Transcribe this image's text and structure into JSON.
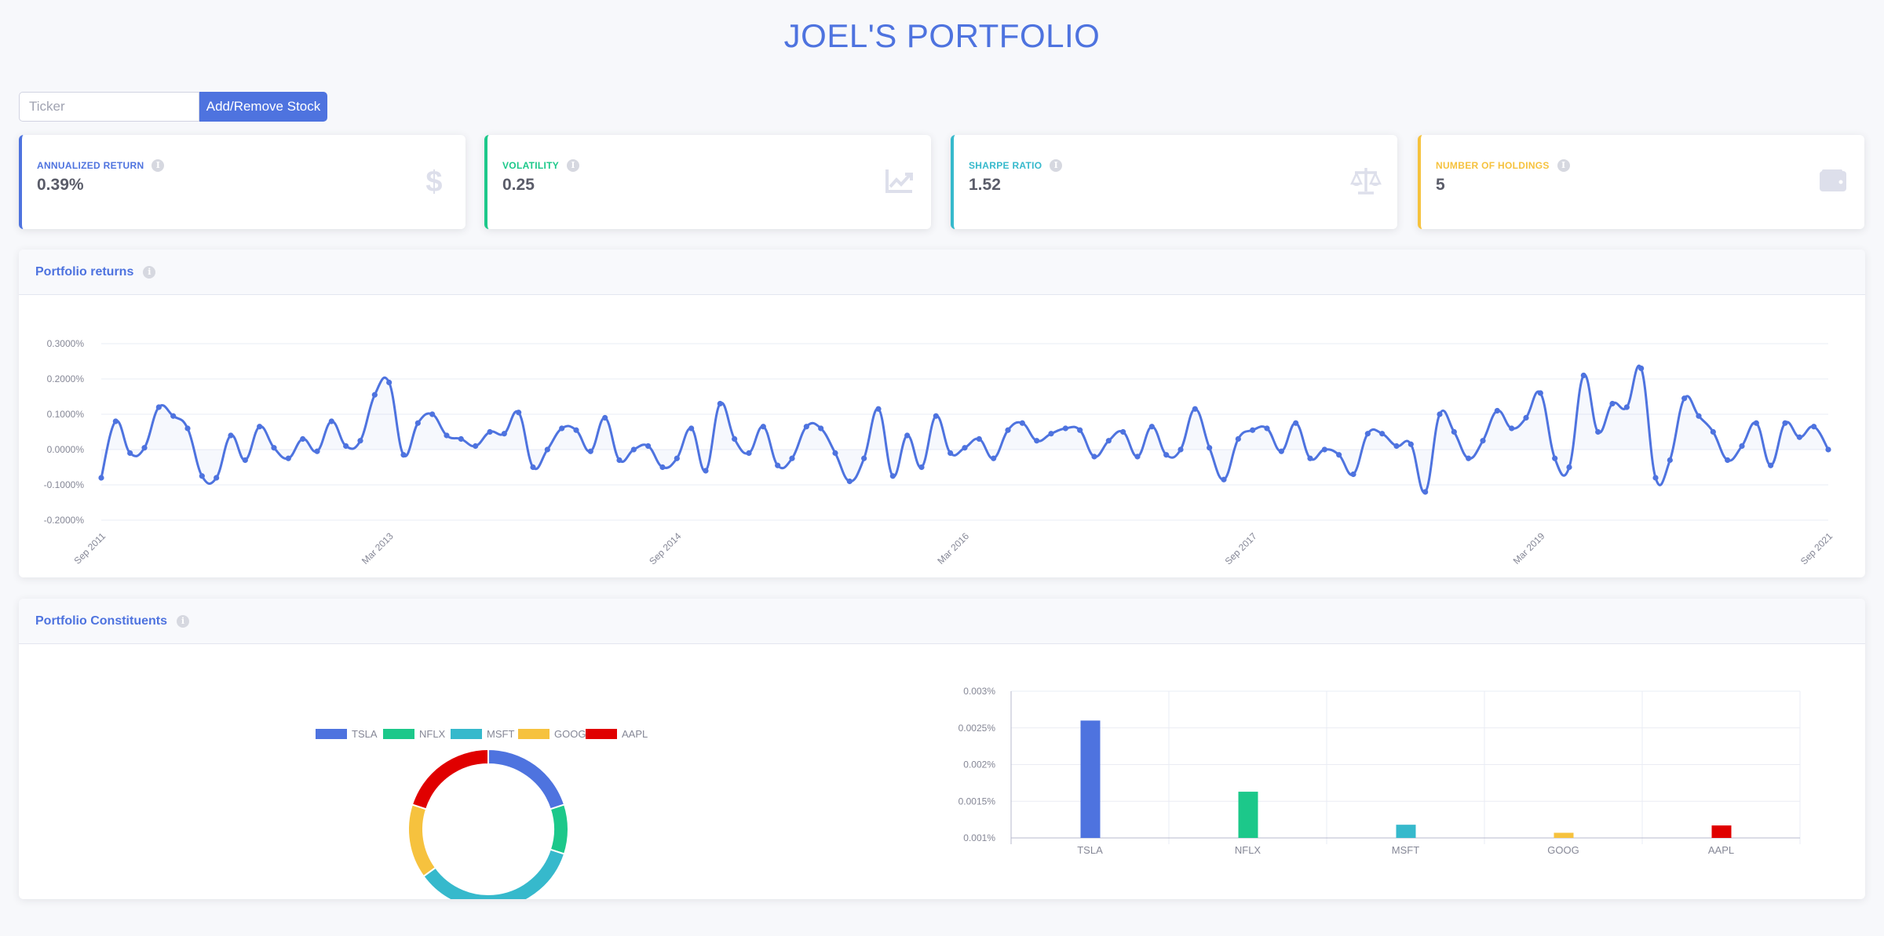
{
  "header": {
    "title": "JOEL'S PORTFOLIO"
  },
  "controls": {
    "ticker_placeholder": "Ticker",
    "add_remove_label": "Add/Remove Stock"
  },
  "info_glyph": "i",
  "stats": [
    {
      "label": "ANNUALIZED RETURN",
      "value": "0.39%",
      "color": "#4e73df",
      "icon": "dollar-icon"
    },
    {
      "label": "VOLATILITY",
      "value": "0.25",
      "color": "#1cc88a",
      "icon": "chart-line-icon"
    },
    {
      "label": "SHARPE RATIO",
      "value": "1.52",
      "color": "#36b9cc",
      "icon": "balance-scale-icon"
    },
    {
      "label": "NUMBER OF HOLDINGS",
      "value": "5",
      "color": "#f6c23e",
      "icon": "wallet-icon"
    }
  ],
  "returns_panel": {
    "title": "Portfolio returns"
  },
  "constituents_panel": {
    "title": "Portfolio Constituents"
  },
  "colors": {
    "primary": "#4e73df",
    "TSLA": "#4e73df",
    "NFLX": "#1cc88a",
    "MSFT": "#36b9cc",
    "GOOG": "#f6c23e",
    "AAPL": "#e00000"
  },
  "chart_data": [
    {
      "type": "line",
      "x_ticks": [
        "Sep 2011",
        "Mar 2013",
        "Sep 2014",
        "Mar 2016",
        "Sep 2017",
        "Mar 2019",
        "Sep 2021"
      ],
      "y_ticks": [
        "0.3000%",
        "0.2000%",
        "0.1000%",
        "0.0000%",
        "-0.1000%",
        "-0.2000%"
      ],
      "ylim": [
        -0.2,
        0.3
      ],
      "y": [
        -0.08,
        0.08,
        -0.01,
        0.005,
        0.12,
        0.095,
        0.06,
        -0.075,
        -0.08,
        0.04,
        -0.03,
        0.065,
        0.005,
        -0.025,
        0.03,
        -0.005,
        0.08,
        0.01,
        0.025,
        0.155,
        0.19,
        -0.015,
        0.075,
        0.1,
        0.04,
        0.03,
        0.01,
        0.05,
        0.045,
        0.105,
        -0.05,
        0.0,
        0.06,
        0.055,
        -0.005,
        0.09,
        -0.03,
        0.0,
        0.01,
        -0.05,
        -0.025,
        0.06,
        -0.06,
        0.13,
        0.03,
        -0.01,
        0.065,
        -0.045,
        -0.025,
        0.065,
        0.06,
        -0.01,
        -0.09,
        -0.025,
        0.115,
        -0.075,
        0.04,
        -0.05,
        0.095,
        -0.01,
        0.005,
        0.03,
        -0.025,
        0.055,
        0.075,
        0.025,
        0.045,
        0.06,
        0.055,
        -0.02,
        0.025,
        0.05,
        -0.02,
        0.065,
        -0.015,
        0.0,
        0.115,
        0.005,
        -0.085,
        0.03,
        0.055,
        0.06,
        -0.005,
        0.075,
        -0.025,
        0.0,
        -0.015,
        -0.07,
        0.045,
        0.045,
        0.01,
        0.015,
        -0.12,
        0.1,
        0.05,
        -0.025,
        0.025,
        0.11,
        0.06,
        0.09,
        0.16,
        -0.025,
        -0.05,
        0.21,
        0.05,
        0.13,
        0.12,
        0.23,
        -0.08,
        -0.03,
        0.145,
        0.095,
        0.05,
        -0.03,
        0.01,
        0.075,
        -0.045,
        0.075,
        0.035,
        0.065,
        0.0
      ]
    },
    {
      "type": "pie",
      "labels": [
        "TSLA",
        "NFLX",
        "MSFT",
        "GOOG",
        "AAPL"
      ],
      "values": [
        20,
        10,
        35,
        15,
        20
      ]
    },
    {
      "type": "bar",
      "categories": [
        "TSLA",
        "NFLX",
        "MSFT",
        "GOOG",
        "AAPL"
      ],
      "values": [
        0.0026,
        0.00163,
        0.00118,
        0.00107,
        0.00117
      ],
      "y_ticks": [
        "0.003%",
        "0.0025%",
        "0.002%",
        "0.0015%",
        "0.001%"
      ],
      "ylim": [
        0.001,
        0.003
      ]
    }
  ]
}
